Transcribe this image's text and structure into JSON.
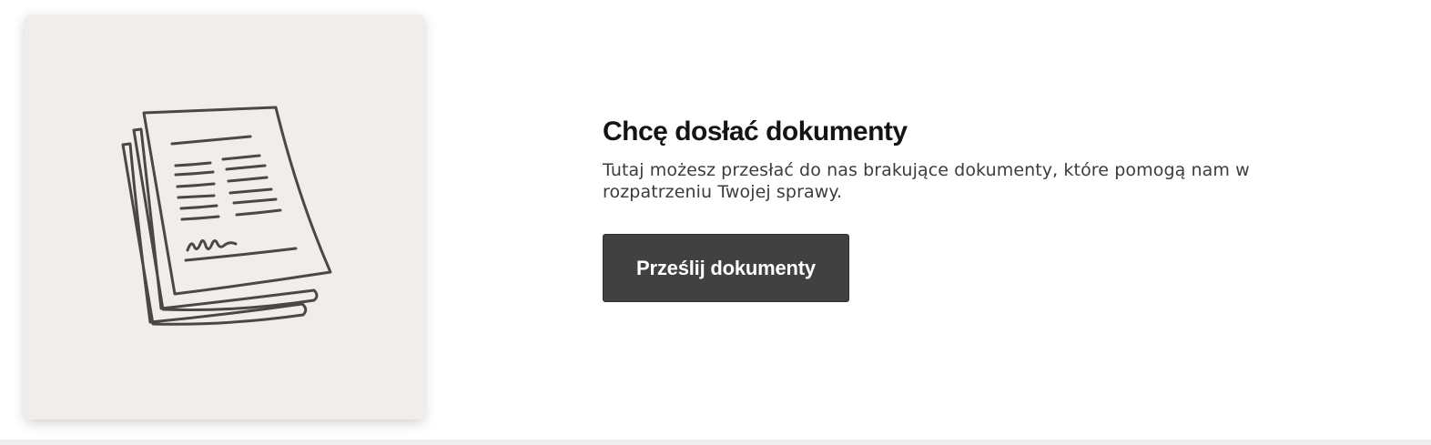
{
  "card": {
    "illustration_icon": "documents-stack-icon",
    "background_color": "#f0edea"
  },
  "content": {
    "title": "Chcę dosłać dokumenty",
    "description": "Tutaj możesz przesłać do nas brakujące dokumenty, które pomogą nam w rozpatrzeniu Twojej sprawy."
  },
  "actions": {
    "upload_label": "Prześlij dokumenty",
    "button_color": "#414141"
  }
}
